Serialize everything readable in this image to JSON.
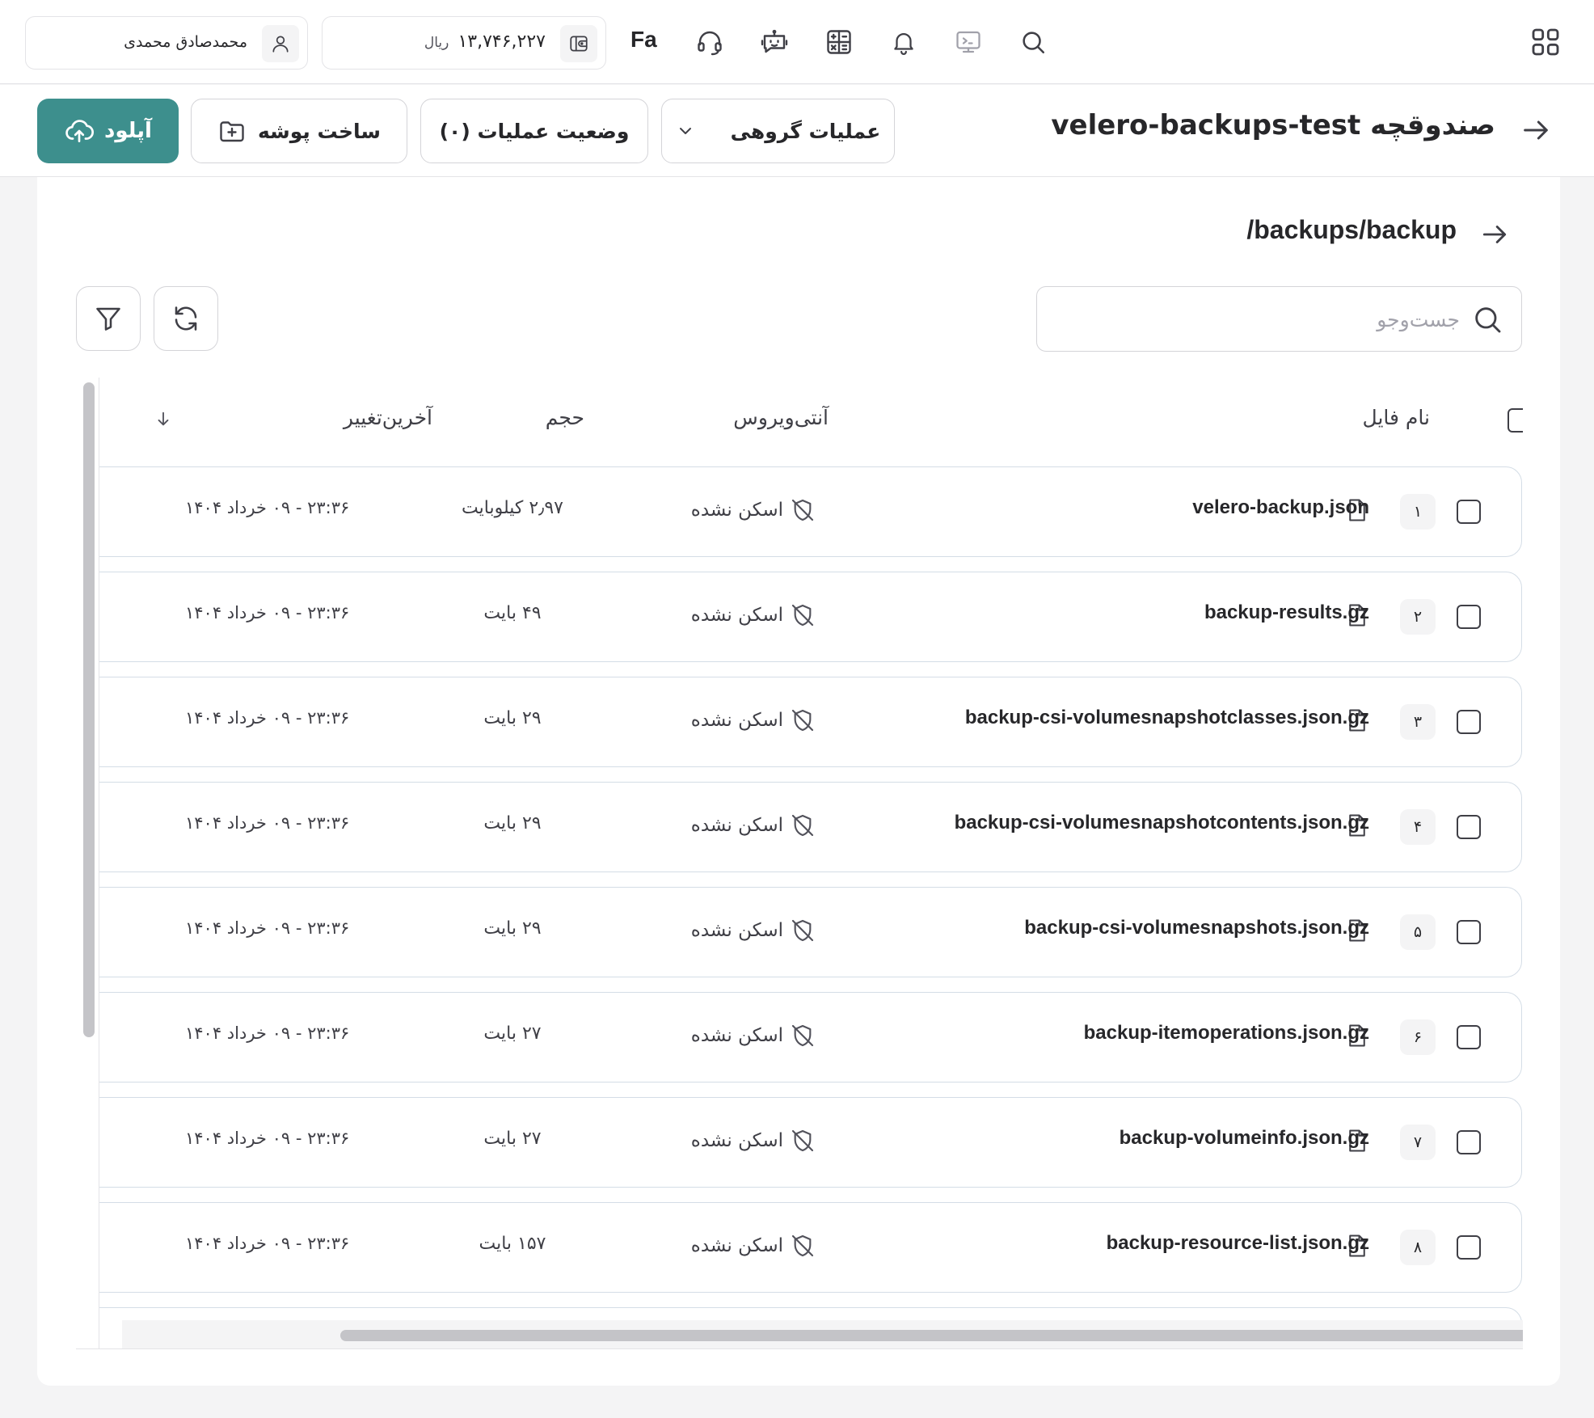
{
  "topbar": {
    "user_name": "محمدصادق محمدی",
    "wallet_amount": "۱۳,۷۴۶,۲۲۷",
    "wallet_currency": "ریال",
    "lang": "Fa",
    "icons": [
      "user-icon",
      "wallet-icon",
      "headset-icon",
      "chat-bot-icon",
      "calculator-icon",
      "bell-icon",
      "terminal-icon",
      "search-icon",
      "apps-grid-icon"
    ]
  },
  "header": {
    "title": "صندوقچه velero-backups-test",
    "upload_label": "آپلود",
    "new_folder_label": "ساخت پوشه",
    "ops_status_label": "وضعیت عملیات (۰)",
    "bulk_ops_label": "عملیات گروهی"
  },
  "content": {
    "path": "/backups/backup",
    "search_placeholder": "جست‌وجو"
  },
  "table": {
    "columns": {
      "name": "نام فایل",
      "antivirus": "آنتی‌ویروس",
      "size": "حجم",
      "modified": "آخرین‌تغییر"
    },
    "rows": [
      {
        "num": "۱",
        "name": "velero-backup.json",
        "antivirus": "اسکن نشده",
        "size": "۲٫۹۷ کیلوبایت",
        "modified": "۲۳:۳۶ - ۰۹ خرداد ۱۴۰۴"
      },
      {
        "num": "۲",
        "name": "backup-results.gz",
        "antivirus": "اسکن نشده",
        "size": "۴۹ بایت",
        "modified": "۲۳:۳۶ - ۰۹ خرداد ۱۴۰۴"
      },
      {
        "num": "۳",
        "name": "backup-csi-volumesnapshotclasses.json.gz",
        "antivirus": "اسکن نشده",
        "size": "۲۹ بایت",
        "modified": "۲۳:۳۶ - ۰۹ خرداد ۱۴۰۴"
      },
      {
        "num": "۴",
        "name": "backup-csi-volumesnapshotcontents.json.gz",
        "antivirus": "اسکن نشده",
        "size": "۲۹ بایت",
        "modified": "۲۳:۳۶ - ۰۹ خرداد ۱۴۰۴"
      },
      {
        "num": "۵",
        "name": "backup-csi-volumesnapshots.json.gz",
        "antivirus": "اسکن نشده",
        "size": "۲۹ بایت",
        "modified": "۲۳:۳۶ - ۰۹ خرداد ۱۴۰۴"
      },
      {
        "num": "۶",
        "name": "backup-itemoperations.json.gz",
        "antivirus": "اسکن نشده",
        "size": "۲۷ بایت",
        "modified": "۲۳:۳۶ - ۰۹ خرداد ۱۴۰۴"
      },
      {
        "num": "۷",
        "name": "backup-volumeinfo.json.gz",
        "antivirus": "اسکن نشده",
        "size": "۲۷ بایت",
        "modified": "۲۳:۳۶ - ۰۹ خرداد ۱۴۰۴"
      },
      {
        "num": "۸",
        "name": "backup-resource-list.json.gz",
        "antivirus": "اسکن نشده",
        "size": "۱۵۷ بایت",
        "modified": "۲۳:۳۶ - ۰۹ خرداد ۱۴۰۴"
      }
    ]
  },
  "colors": {
    "accent": "#3d8f8d",
    "page_bg": "#f4f4f5",
    "text": "#27272a",
    "icon": "#52525b"
  }
}
